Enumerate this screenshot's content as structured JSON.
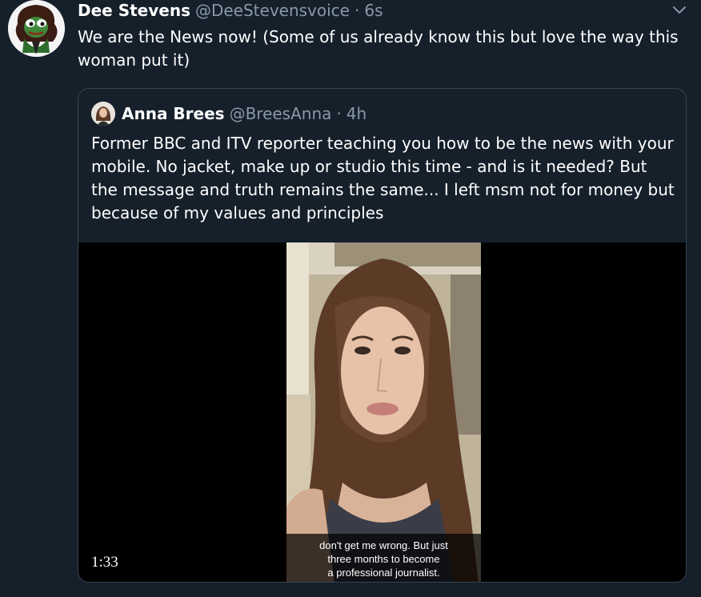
{
  "tweet": {
    "author_name": "Dee Stevens",
    "author_handle": "@DeeStevensvoice",
    "separator": "·",
    "time": "6s",
    "text": "We are the News now! (Some of us already know this but love the way this woman put it)",
    "avatar_icon": "frog-avatar-icon",
    "menu_icon": "chevron-down-icon"
  },
  "quote": {
    "author_name": "Anna Brees",
    "author_handle": "@BreesAnna",
    "separator": "·",
    "time": "4h",
    "text": "Former BBC and ITV reporter teaching you how to be the news with your mobile. No jacket, make up or studio this time - and is it needed? But the message and truth remains the same... I left msm not for money but because of my values and principles",
    "avatar_icon": "person-avatar-icon",
    "video": {
      "caption_line1": "don't get me wrong. But just",
      "caption_line2": "three months to become",
      "caption_line3": "a professional journalist.",
      "duration": "1:33"
    }
  },
  "colors": {
    "background": "#15202b",
    "border": "#38444d",
    "secondary_text": "#8899a6",
    "primary_text": "#ffffff"
  }
}
